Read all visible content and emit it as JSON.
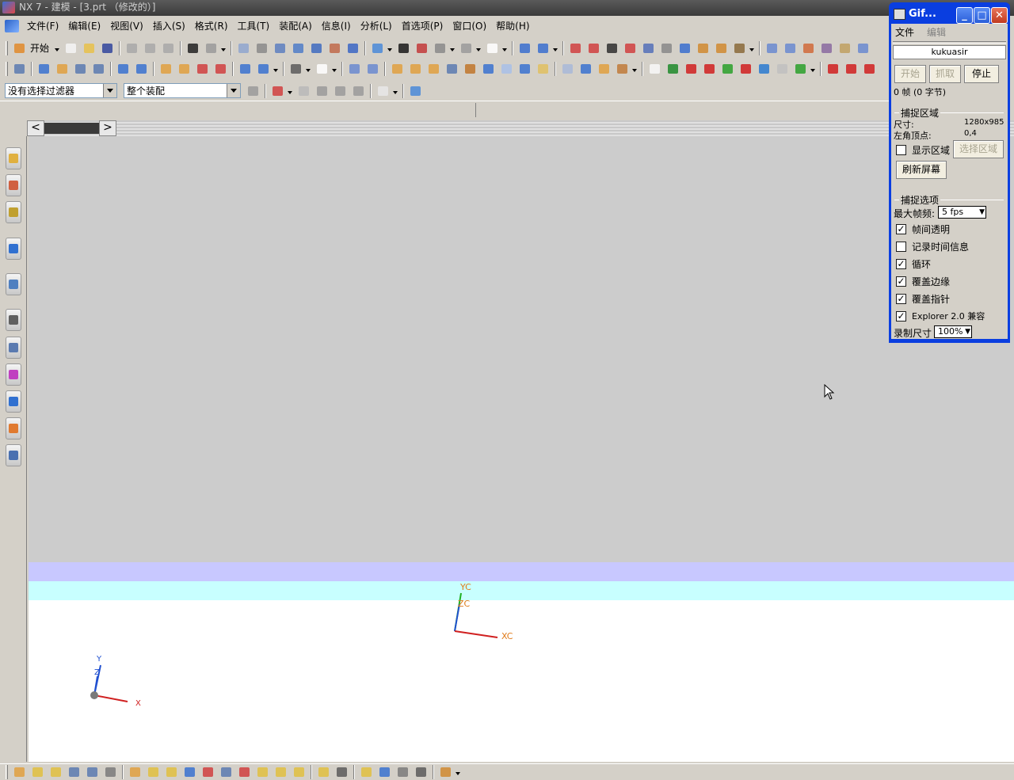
{
  "title_bar": {
    "text": "NX 7 - 建模 - [3.prt （修改的）]"
  },
  "menu_bar": {
    "items": [
      "文件(F)",
      "编辑(E)",
      "视图(V)",
      "插入(S)",
      "格式(R)",
      "工具(T)",
      "装配(A)",
      "信息(I)",
      "分析(L)",
      "首选项(P)",
      "窗口(O)",
      "帮助(H)"
    ]
  },
  "standard_toolbar": {
    "start_label": "开始"
  },
  "selection_bar": {
    "filter_value": "没有选择过滤器",
    "scope_value": "整个装配"
  },
  "scroll": {
    "left_arrow": "<",
    "right_arrow": ">"
  },
  "viewport": {
    "work_csys": {
      "x_label": "XC",
      "y_label": "YC",
      "z_label": "ZC"
    },
    "absolute_csys": {
      "x_label": "X",
      "y_label": "Y",
      "z_label": "Z"
    },
    "colors": {
      "background": "#cccccc",
      "band_blue": "#c8c8ff",
      "band_cyan": "#c8ffff",
      "axis_label": "#e07b1a"
    }
  },
  "gif_window": {
    "title": "Gif...",
    "menu": [
      "文件",
      "编辑"
    ],
    "author": "kukuasir",
    "buttons": {
      "start": "开始",
      "capture": "抓取",
      "stop": "停止"
    },
    "frame_info": "0 帧 (0 字节)",
    "capture_area": {
      "heading": "捕捉区域",
      "size_label": "尺寸:",
      "size_value": "1280x985",
      "corner_label": "左角顶点:",
      "corner_value": "0,4",
      "show_area_label": "显示区域",
      "select_area_button": "选择区域",
      "refresh_button": "刷新屏幕"
    },
    "capture_options": {
      "heading": "捕捉选项",
      "max_fps_label": "最大帧频:",
      "max_fps_value": "5 fps",
      "options": [
        {
          "label": "帧间透明",
          "checked": true
        },
        {
          "label": "记录时间信息",
          "checked": false
        },
        {
          "label": "循环",
          "checked": true
        },
        {
          "label": "覆盖边缘",
          "checked": true
        },
        {
          "label": "覆盖指针",
          "checked": true
        },
        {
          "label": "Explorer 2.0 兼容",
          "checked": true
        }
      ],
      "record_size_label": "录制尺寸",
      "record_size_value": "100%"
    }
  }
}
